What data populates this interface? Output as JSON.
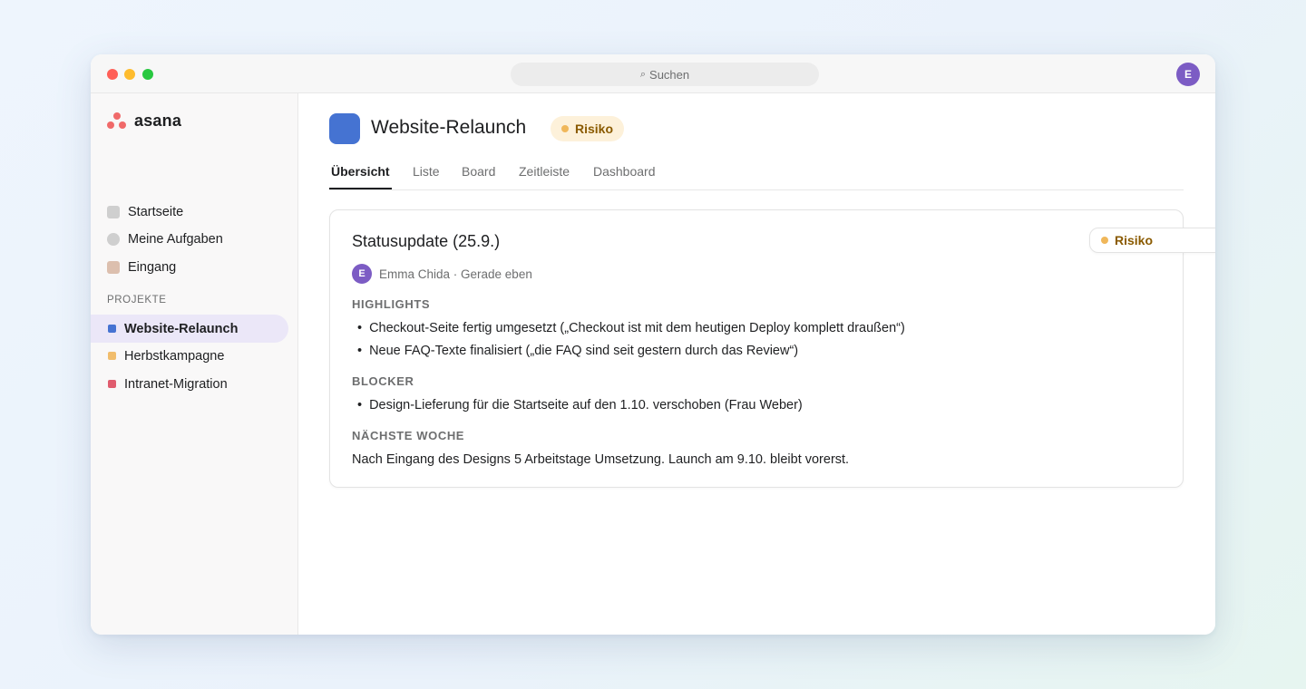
{
  "titlebar": {
    "search_placeholder": "Suchen",
    "search_icon": "search-icon",
    "user_initial": "E"
  },
  "sidebar": {
    "brand": "asana",
    "nav": [
      {
        "label": "Startseite",
        "icon": "home-icon"
      },
      {
        "label": "Meine Aufgaben",
        "icon": "check-circle-icon"
      },
      {
        "label": "Eingang",
        "icon": "inbox-icon"
      }
    ],
    "projects_heading": "PROJEKTE",
    "projects": [
      {
        "label": "Website-Relaunch",
        "color": "#4573d2",
        "active": true
      },
      {
        "label": "Herbstkampagne",
        "color": "#f1bd6c",
        "active": false
      },
      {
        "label": "Intranet-Migration",
        "color": "#e05c6e",
        "active": false
      }
    ]
  },
  "project": {
    "title": "Website-Relaunch",
    "color": "#4573d2",
    "status_label": "Risiko",
    "status_color": "#f0b75a"
  },
  "tabs": [
    {
      "label": "Übersicht",
      "active": true
    },
    {
      "label": "Liste",
      "active": false
    },
    {
      "label": "Board",
      "active": false
    },
    {
      "label": "Zeitleiste",
      "active": false
    },
    {
      "label": "Dashboard",
      "active": false
    }
  ],
  "status_update": {
    "title": "Statusupdate (25.9.)",
    "status_label": "Risiko",
    "author_initial": "E",
    "author_line": "Emma Chida · Gerade eben",
    "highlights_heading": "HIGHLIGHTS",
    "highlights": [
      "Checkout-Seite fertig umgesetzt („Checkout ist mit dem heutigen Deploy komplett draußen“)",
      "Neue FAQ-Texte finalisiert („die FAQ sind seit gestern durch das Review“)"
    ],
    "blocker_heading": "BLOCKER",
    "blockers": [
      "Design-Lieferung für die Startseite auf den 1.10. verschoben (Frau Weber)"
    ],
    "next_week_heading": "NÄCHSTE WOCHE",
    "next_week_text": "Nach Eingang des Designs 5 Arbeitstage Umsetzung. Launch am 9.10. bleibt vorerst."
  }
}
